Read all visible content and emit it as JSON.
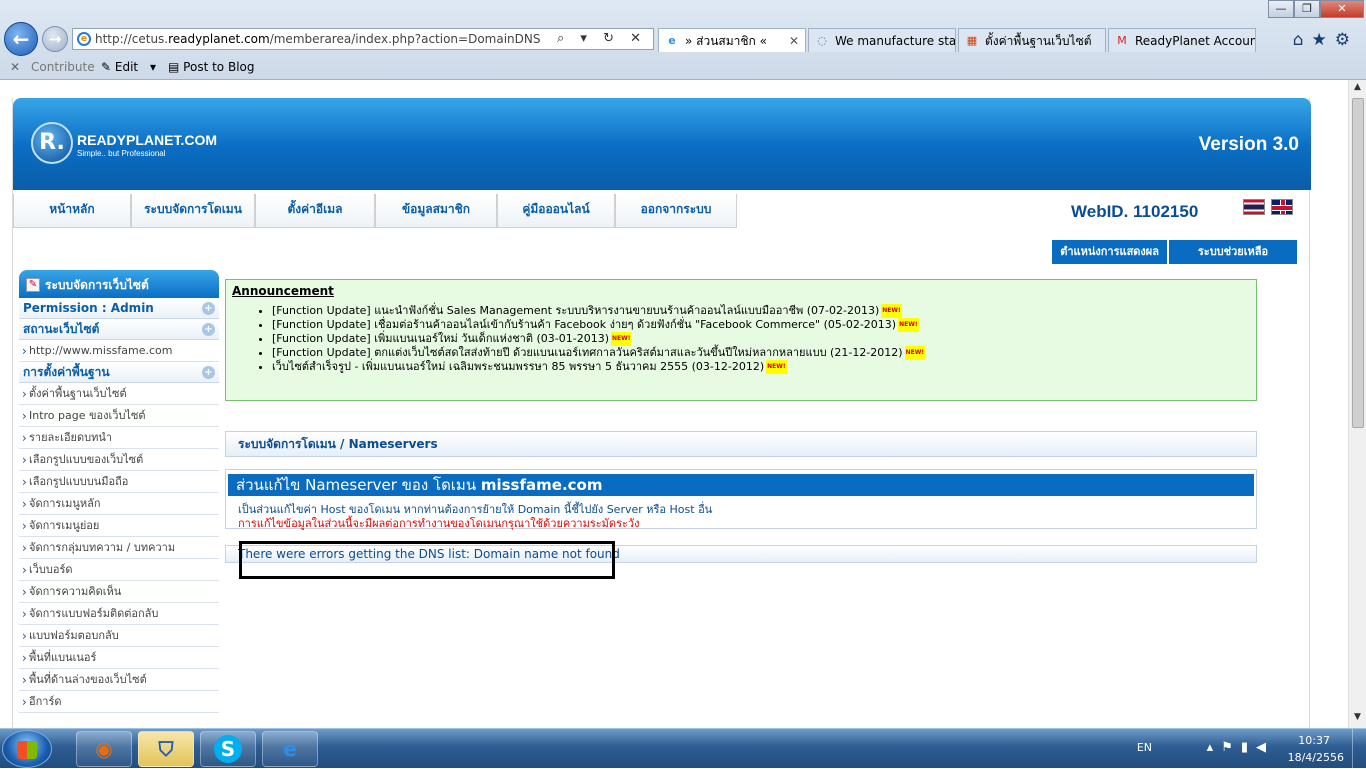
{
  "browser": {
    "address": {
      "prefix": "http://cetus.",
      "domain": "readyplanet.com",
      "path": "/memberarea/index.php?action=DomainDNS"
    },
    "addr_tools": "⌕ ▾ ↻ ✕",
    "tabs": [
      {
        "label": "» ส่วนสมาชิก «",
        "icon": "ie-icon",
        "active": true
      },
      {
        "label": "We manufacture stai...",
        "icon": "loading-icon"
      },
      {
        "label": "ตั้งค่าพื้นฐานเว็บไซต์",
        "icon": "windows-icon"
      },
      {
        "label": "ReadyPlanet Accoun...",
        "icon": "gmail-icon"
      }
    ],
    "toolbar_icons": "⌂★⚙",
    "cmdbar": {
      "close": "✕",
      "contribute": "Contribute",
      "edit": "Edit",
      "post": "Post to Blog"
    }
  },
  "site": {
    "logo_name": "READYPLANET.COM",
    "logo_tag": "Simple.. but Professional",
    "logo_letter": "R.",
    "version": "Version 3.0",
    "nav": [
      "หน้าหลัก",
      "ระบบจัดการโดเมน",
      "ตั้งค่าอีเมล",
      "ข้อมูลสมาชิก",
      "คู่มือออนไลน์",
      "ออกจากระบบ"
    ],
    "webid": "WebID. 1102150",
    "subnav": [
      "ตำแหน่งการแสดงผล",
      "ระบบช่วยเหลือ"
    ],
    "sidebar": {
      "title": "ระบบจัดการเว็บไซต์",
      "sections": [
        {
          "label": "Permission : Admin",
          "items": []
        },
        {
          "label": "สถานะเว็บไซต์",
          "items": [
            "http://www.missfame.com"
          ]
        },
        {
          "label": "การตั้งค่าพื้นฐาน",
          "items": [
            "ตั้งค่าพื้นฐานเว็บไซต์",
            "Intro page ของเว็บไซต์",
            "รายละเอียดบทนำ",
            "เลือกรูปแบบของเว็บไซต์",
            "เลือกรูปแบบบนมือถือ",
            "จัดการเมนูหลัก",
            "จัดการเมนูย่อย",
            "จัดการกลุ่มบทความ / บทความ",
            "เว็บบอร์ด",
            "จัดการความคิดเห็น",
            "จัดการแบบฟอร์มติดต่อกลับ",
            "แบบฟอร์มตอบกลับ",
            "พื้นที่แบนเนอร์",
            "พื้นที่ด้านล่างของเว็บไซต์",
            "อีการ์ด"
          ]
        }
      ]
    },
    "announcement": {
      "title": "Announcement",
      "new_badge": "NEW!",
      "items": [
        "[Function Update] แนะนำฟังก์ชั่น Sales Management ระบบบริหารงานขายบนร้านค้าออนไลน์แบบมืออาชีพ (07-02-2013)",
        "[Function Update] เชื่อมต่อร้านค้าออนไลน์เข้ากับร้านค้า Facebook ง่ายๆ ด้วยฟังก์ชั่น \"Facebook Commerce\" (05-02-2013)",
        "[Function Update] เพิ่มแบนเนอร์ใหม่ วันเด็กแห่งชาติ (03-01-2013)",
        "[Function Update] ตกแต่งเว็บไซต์สดใสส่งท้ายปี ด้วยแบนเนอร์เทศกาลวันคริสต์มาสและวันขึ้นปีใหม่หลากหลายแบบ (21-12-2012)",
        "เว็บไซต์สำเร็จรูป - เพิ่มแบนเนอร์ใหม่ เฉลิมพระชนมพรรษา 85 พรรษา 5 ธันวาคม 2555 (03-12-2012)"
      ]
    },
    "breadcrumb": "ระบบจัดการโดเมน / Nameservers",
    "edit": {
      "title_prefix": "ส่วนแก้ไข Nameserver ของ โดเมน",
      "domain": "missfame.com",
      "desc": "เป็นส่วนแก้ไขค่า Host ของโดเมน หากท่านต้องการย้ายให้ Domain นี้ชี้ไปยัง Server หรือ Host อื่น",
      "warning": "การแก้ไขข้อมูลในส่วนนี้จะมีผลต่อการทำงานของโดเมนกรุณาใช้ด้วยความระมัดระวัง"
    },
    "error": "There were errors getting the DNS list: Domain name not found"
  },
  "taskbar": {
    "lang": "EN",
    "time": "10:37",
    "date": "18/4/2556"
  },
  "colors": {
    "brand_blue": "#0a6cc0",
    "announce_bg": "#e6fbe2",
    "warning_red": "#e00"
  }
}
